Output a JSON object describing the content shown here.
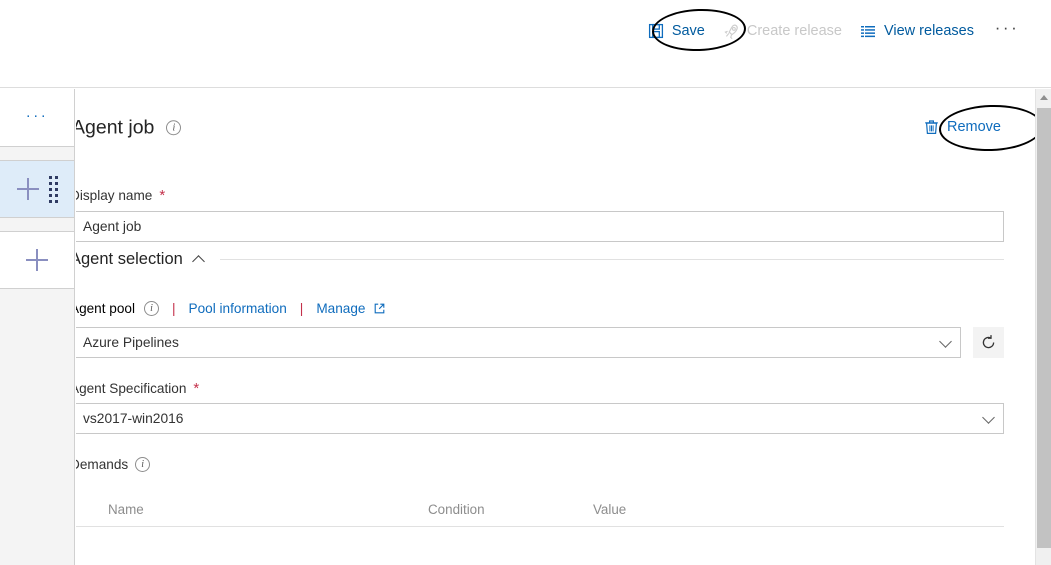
{
  "toolbar": {
    "save": {
      "label": "Save",
      "icon": "save-disk-icon",
      "enabled": true
    },
    "create_release": {
      "label": "Create release",
      "icon": "rocket-icon",
      "enabled": false
    },
    "view_releases": {
      "label": "View releases",
      "icon": "list-icon",
      "enabled": true
    },
    "overflow": {
      "label": "···",
      "icon": "ellipsis-icon"
    }
  },
  "left_rail": {
    "overflow_label": "···",
    "rows": [
      {
        "name": "pipeline-overflow",
        "type": "ellipsis"
      },
      {
        "name": "add-agent-job",
        "type": "add",
        "selected": true,
        "has_drag_handle": true
      },
      {
        "name": "add-stage",
        "type": "add",
        "selected": false,
        "has_drag_handle": false
      }
    ]
  },
  "panel": {
    "title": "Agent job",
    "title_info_icon": "info-icon",
    "remove": {
      "label": "Remove",
      "icon": "trash-icon"
    }
  },
  "form": {
    "display_name": {
      "label": "Display name",
      "required_marker": "*",
      "value": "Agent job",
      "placeholder": "Agent job"
    },
    "agent_selection": {
      "section_label": "Agent selection",
      "collapse_icon": "chevron-up-icon",
      "agent_pool": {
        "label": "Agent pool",
        "info_icon": "info-icon",
        "separator": "|",
        "pool_information_link": "Pool information",
        "manage_link": "Manage",
        "manage_external_icon": "external-link-icon",
        "selected_value": "Azure Pipelines",
        "dropdown_icon": "chevron-down-icon",
        "refresh_icon": "refresh-icon"
      },
      "agent_specification": {
        "label": "Agent Specification",
        "required_marker": "*",
        "selected_value": "vs2017-win2016",
        "dropdown_icon": "chevron-down-icon"
      },
      "demands": {
        "label": "Demands",
        "info_icon": "info-icon",
        "columns": [
          "Name",
          "Condition",
          "Value"
        ],
        "rows": []
      }
    }
  },
  "scrollbar": {
    "orientation": "vertical",
    "up_arrow_icon": "caret-up-icon"
  },
  "annotations": [
    {
      "name": "save-highlight-ellipse",
      "target": "save-button",
      "shape": "ellipse",
      "color": "#000000"
    },
    {
      "name": "remove-highlight-ellipse",
      "target": "remove-button",
      "shape": "ellipse",
      "color": "#000000"
    }
  ],
  "colors": {
    "accent_link": "#0f6cbd",
    "accent_link_dark": "#005a9e",
    "selected_row_bg": "#deecf9",
    "rail_bg": "#f4f4f4",
    "required_red": "#c4314b",
    "border": "#c8c8c8",
    "annotation": "#000000"
  }
}
